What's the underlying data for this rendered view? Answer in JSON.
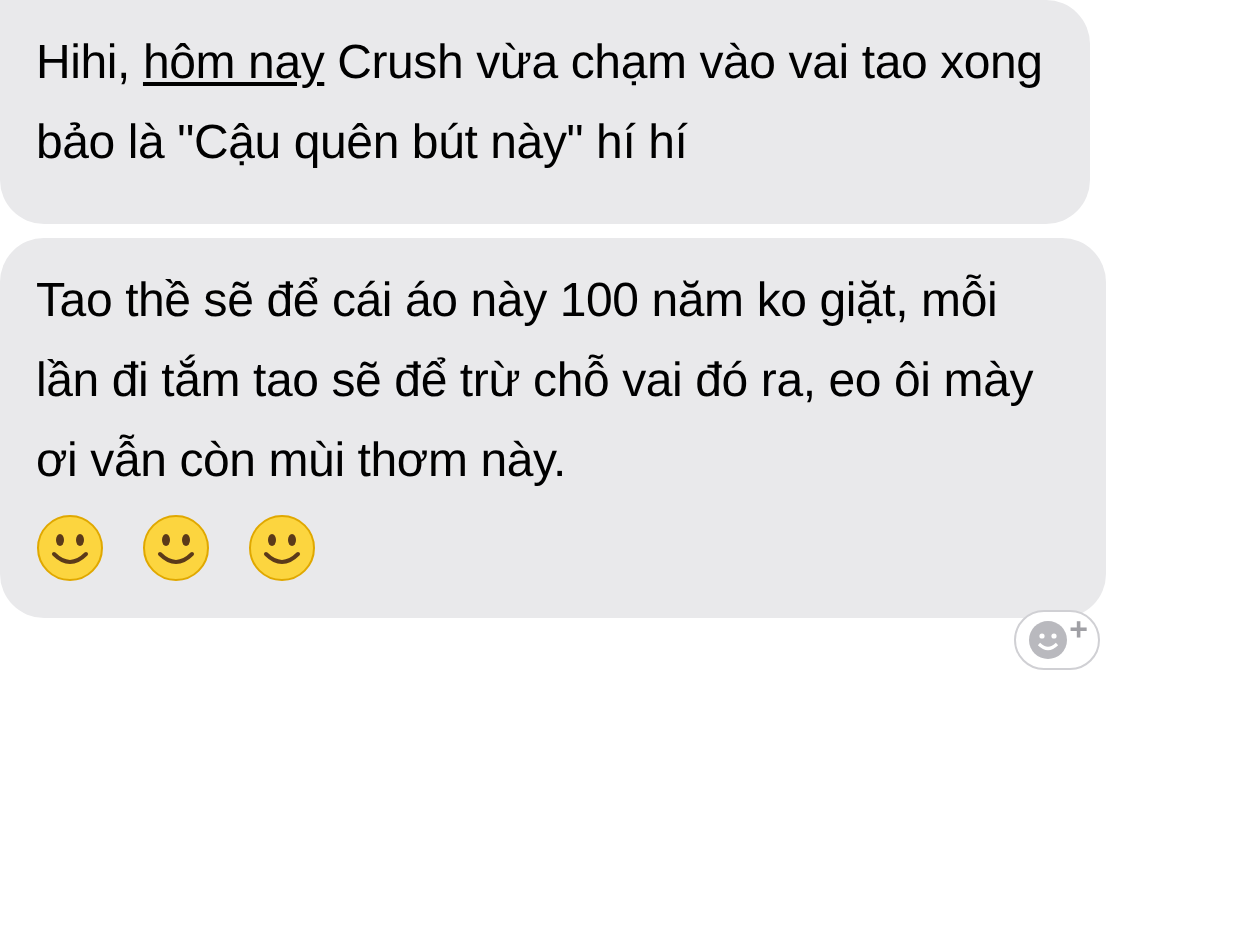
{
  "messages": [
    {
      "parts": [
        {
          "kind": "text",
          "text": "Hihi, "
        },
        {
          "kind": "link",
          "text": "hôm nay"
        },
        {
          "kind": "text",
          "text": " Crush vừa chạm vào vai tao xong bảo là \"Cậu quên bút này\" hí hí"
        }
      ]
    },
    {
      "parts": [
        {
          "kind": "text",
          "text": "Tao thề sẽ để cái áo này 100 năm ko giặt, mỗi lần đi tắm tao sẽ để trừ chỗ vai đó ra, eo ôi mày ơi vẫn còn mùi thơm này."
        }
      ],
      "emojis": [
        {
          "kind": "smiley"
        },
        {
          "kind": "smiley"
        },
        {
          "kind": "smiley"
        }
      ],
      "add_reaction": {
        "label": "+"
      }
    }
  ]
}
